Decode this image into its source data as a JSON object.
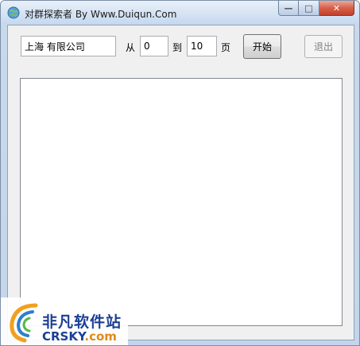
{
  "window": {
    "title": "对群探索者 By Www.Duiqun.Com",
    "caption_minimize": "—",
    "caption_maximize": "□",
    "caption_close": "✕"
  },
  "form": {
    "company_value": "上海 有限公司",
    "from_label": "从",
    "from_value": "0",
    "to_label": "到",
    "to_value": "10",
    "page_label": "页",
    "start_label": "开始",
    "exit_label": "退出"
  },
  "output": {
    "content": ""
  },
  "watermark": {
    "cn_text": "非凡软件站",
    "en_main": "CRSKY",
    "en_suffix": ".com"
  },
  "colors": {
    "accent": "#1c3f94",
    "close_button": "#c2402a"
  }
}
